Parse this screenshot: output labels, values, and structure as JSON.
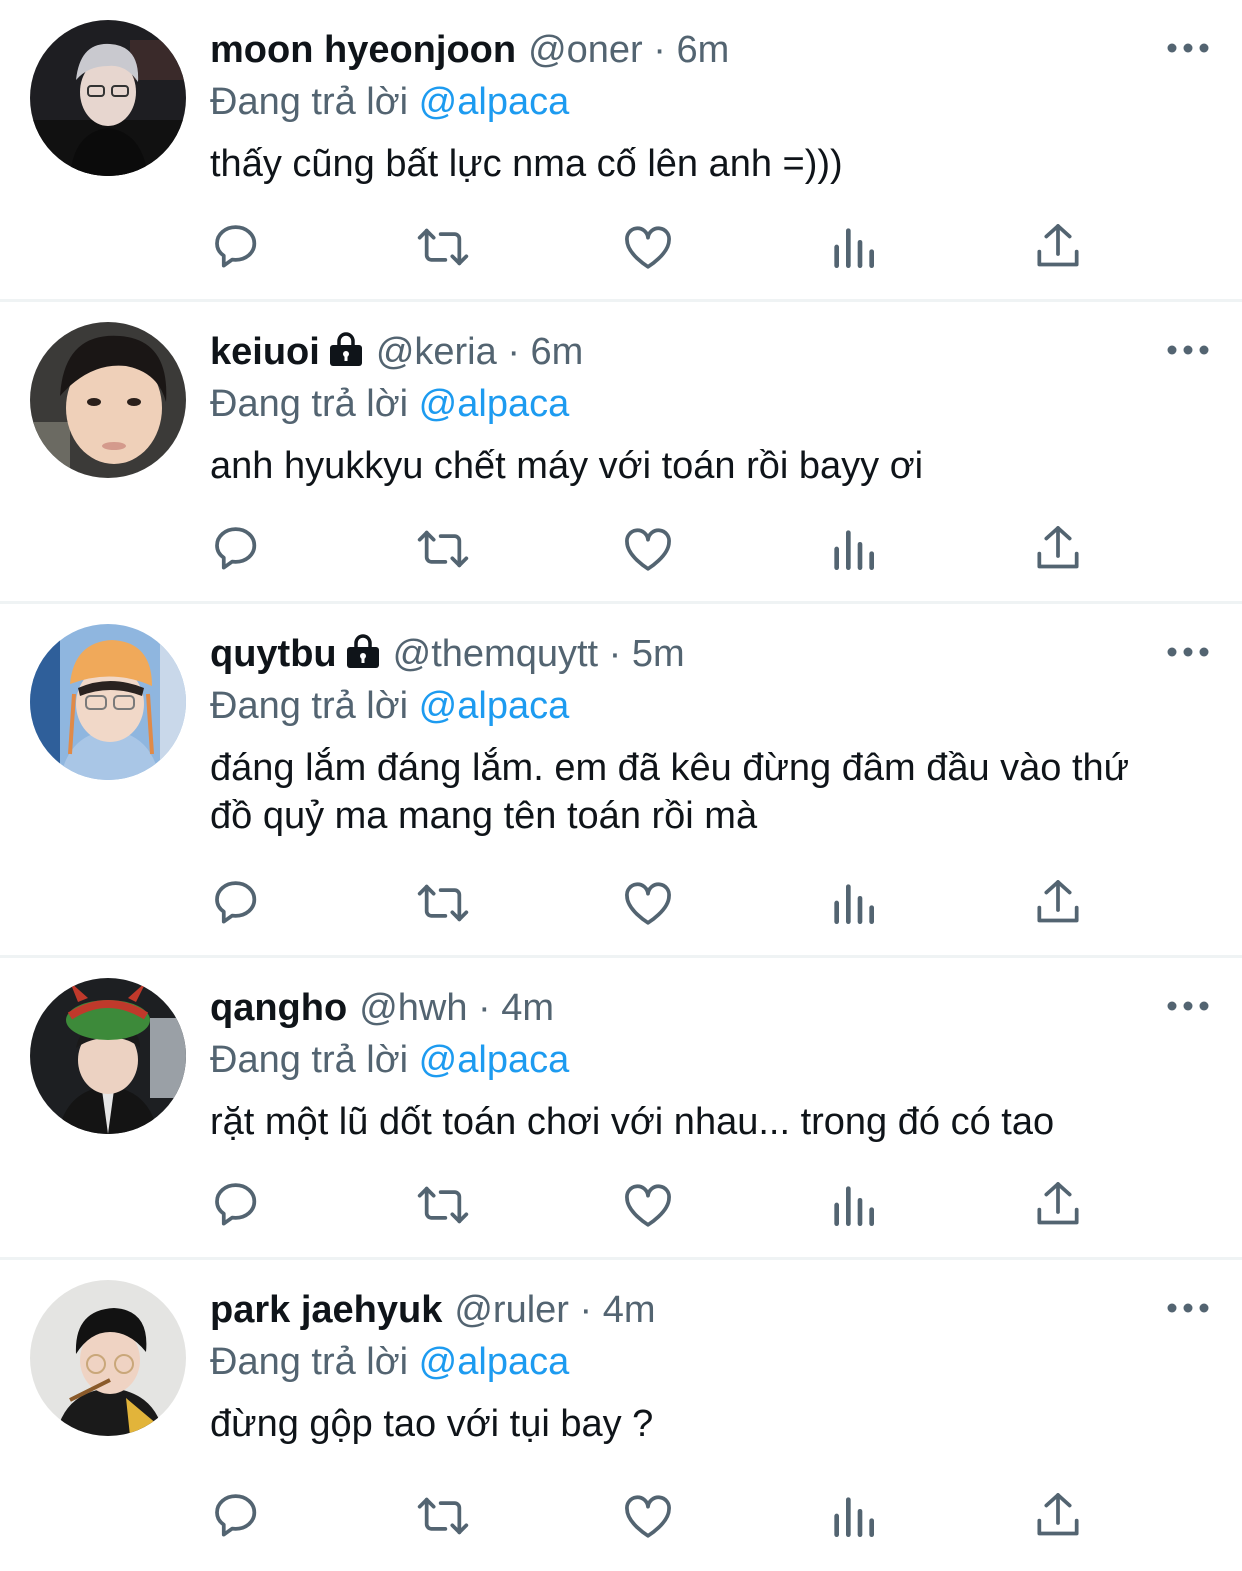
{
  "reply_prefix": "Đang trả lời",
  "colors": {
    "accent": "#1d9bf0",
    "secondary_text": "#536471",
    "divider": "#eff3f4"
  },
  "icons": [
    "reply-icon",
    "retweet-icon",
    "like-icon",
    "views-icon",
    "share-icon",
    "more-icon",
    "lock-icon"
  ],
  "tweets": [
    {
      "display_name": "moon hyeonjoon",
      "handle": "@oner",
      "time": "6m",
      "locked": false,
      "reply_to": "@alpaca",
      "text": "thấy cũng bất lực nma cố lên anh =)))"
    },
    {
      "display_name": "keiuoi",
      "handle": "@keria",
      "time": "6m",
      "locked": true,
      "reply_to": "@alpaca",
      "text": "anh hyukkyu chết máy với toán rồi bayy ơi"
    },
    {
      "display_name": "quytbu",
      "handle": "@themquytt",
      "time": "5m",
      "locked": true,
      "reply_to": "@alpaca",
      "text": "đáng lắm đáng lắm. em đã kêu đừng đâm đầu vào thứ đồ quỷ ma mang tên toán rồi mà"
    },
    {
      "display_name": "qangho",
      "handle": "@hwh",
      "time": "4m",
      "locked": false,
      "reply_to": "@alpaca",
      "text": "rặt một lũ dốt toán chơi với nhau... trong đó có tao"
    },
    {
      "display_name": "park jaehyuk",
      "handle": "@ruler",
      "time": "4m",
      "locked": false,
      "reply_to": "@alpaca",
      "text": "đừng gộp tao với tụi bay ?"
    }
  ]
}
